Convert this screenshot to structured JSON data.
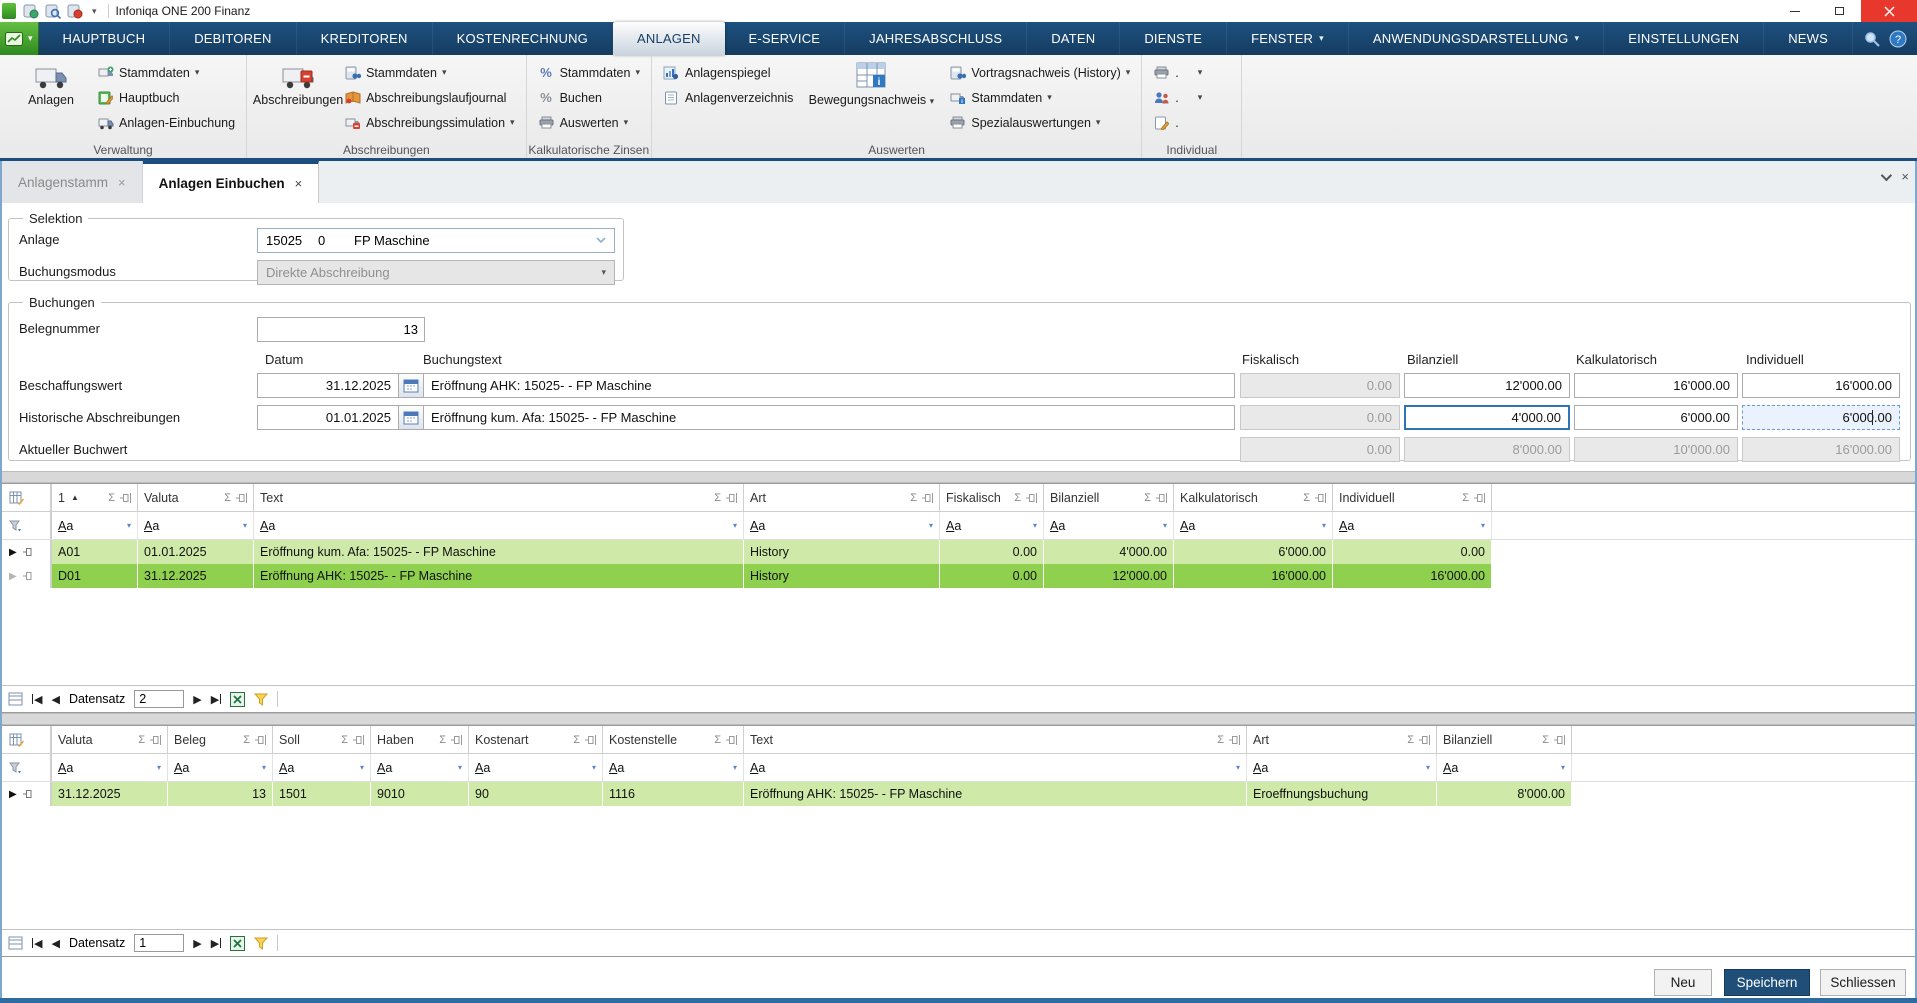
{
  "window": {
    "title": "Infoniqa ONE 200 Finanz"
  },
  "colors": {
    "menubar_blue": "#1d5181",
    "accent_blue": "#1b4e7e",
    "app_button_green": "#3f9a28",
    "close_button_red": "#e8372c",
    "row_green_light": "#cfeaa8",
    "row_green_selected": "#8fd14f",
    "disabled_field_bg": "#e9e9e9",
    "focus_border": "#2e75b6",
    "save_button_bg": "#1f4e79"
  },
  "icons": {
    "dropdown": "▾",
    "sum": "Σ",
    "sort_asc": "▲",
    "prev": "◀",
    "next": "▶",
    "tab_close": "×",
    "help": "?"
  },
  "menubar": {
    "active_tab": "ANLAGEN",
    "tabs": [
      "HAUPTBUCH",
      "DEBITOREN",
      "KREDITOREN",
      "KOSTENRECHNUNG",
      "ANLAGEN",
      "E-SERVICE",
      "JAHRESABSCHLUSS",
      "DATEN",
      "DIENSTE",
      "FENSTER",
      "ANWENDUNGSDARSTELLUNG",
      "EINSTELLUNGEN",
      "NEWS"
    ]
  },
  "ribbon": {
    "groups": [
      {
        "label": "Verwaltung",
        "big_label": "Anlagen",
        "items": [
          {
            "label": "Stammdaten"
          },
          {
            "label": "Hauptbuch"
          },
          {
            "label": "Anlagen-Einbuchung"
          }
        ]
      },
      {
        "label": "Abschreibungen",
        "big_label": "Abschreibungen",
        "items": [
          {
            "label": "Stammdaten"
          },
          {
            "label": "Abschreibungslaufjournal"
          },
          {
            "label": "Abschreibungssimulation"
          }
        ]
      },
      {
        "label": "Kalkulatorische Zinsen",
        "items": [
          {
            "label": "Stammdaten"
          },
          {
            "label": "Buchen"
          },
          {
            "label": "Auswerten"
          }
        ]
      },
      {
        "label": "Auswerten",
        "big_label": "Bewegungsnachweis",
        "items": [
          {
            "label": "Anlagenspiegel"
          },
          {
            "label": "Anlagenverzeichnis"
          }
        ],
        "items2": [
          {
            "label": "Vortragsnachweis (History)"
          },
          {
            "label": "Stammdaten"
          },
          {
            "label": "Spezialauswertungen"
          }
        ]
      },
      {
        "label": "Individual",
        "items": [
          {
            "label": "."
          },
          {
            "label": "."
          },
          {
            "label": "."
          }
        ]
      }
    ]
  },
  "doc_tabs": [
    {
      "label": "Anlagenstamm"
    },
    {
      "label": "Anlagen Einbuchen"
    }
  ],
  "selektion": {
    "legend": "Selektion",
    "anlage_label": "Anlage",
    "anlage_nr": "15025",
    "anlage_sub": "0",
    "anlage_name": "FP Maschine",
    "buchungsmodus_label": "Buchungsmodus",
    "buchungsmodus_value": "Direkte Abschreibung"
  },
  "buchungen": {
    "legend": "Buchungen",
    "belegnummer_label": "Belegnummer",
    "belegnummer_value": "13",
    "col_headers": [
      "Datum",
      "Buchungstext",
      "Fiskalisch",
      "Bilanziell",
      "Kalkulatorisch",
      "Individuell"
    ],
    "rows": [
      {
        "label": "Beschaffungswert",
        "datum": "31.12.2025",
        "text": "Eröffnung AHK: 15025- - FP Maschine",
        "fiskalisch": "0.00",
        "bilanziell": "12'000.00",
        "kalkulatorisch": "16'000.00",
        "individuell": "16'000.00"
      },
      {
        "label": "Historische Abschreibungen",
        "datum": "01.01.2025",
        "text": "Eröffnung kum. Afa: 15025- - FP Maschine",
        "fiskalisch": "0.00",
        "bilanziell": "4'000.00",
        "kalkulatorisch": "6'000.00",
        "individuell": "6'000.00"
      },
      {
        "label": "Aktueller Buchwert",
        "fiskalisch": "0.00",
        "bilanziell": "8'000.00",
        "kalkulatorisch": "10'000.00",
        "individuell": "16'000.00"
      }
    ]
  },
  "grid_common": {
    "filter": "Aa",
    "record_label": "Datensatz"
  },
  "grid1": {
    "columns": [
      "1",
      "Valuta",
      "Text",
      "Art",
      "Fiskalisch",
      "Bilanziell",
      "Kalkulatorisch",
      "Individuell"
    ],
    "rows": [
      [
        "A01",
        "01.01.2025",
        "Eröffnung kum. Afa: 15025- - FP Maschine",
        "History",
        "0.00",
        "4'000.00",
        "6'000.00",
        "0.00"
      ],
      [
        "D01",
        "31.12.2025",
        "Eröffnung AHK: 15025- - FP Maschine",
        "History",
        "0.00",
        "12'000.00",
        "16'000.00",
        "16'000.00"
      ]
    ],
    "record_value": "2"
  },
  "grid2": {
    "columns": [
      "Valuta",
      "Beleg",
      "Soll",
      "Haben",
      "Kostenart",
      "Kostenstelle",
      "Text",
      "Art",
      "Bilanziell"
    ],
    "rows": [
      [
        "31.12.2025",
        "13",
        "1501",
        "9010",
        "90",
        "1116",
        "Eröffnung AHK: 15025- - FP Maschine",
        "Eroeffnungsbuchung",
        "8'000.00"
      ]
    ],
    "record_value": "1"
  },
  "footer": {
    "neu": "Neu",
    "speichern": "Speichern",
    "schliessen": "Schliessen"
  }
}
